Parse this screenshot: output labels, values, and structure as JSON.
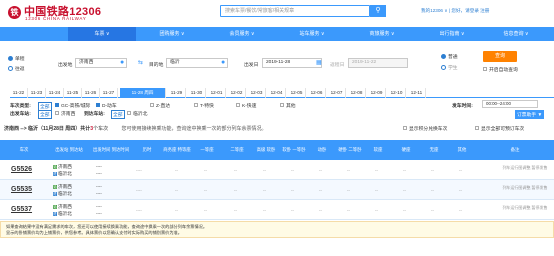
{
  "header": {
    "logo_char": "铁",
    "site_name": "中国铁路12306",
    "site_en": "12306 CHINA RAILWAY",
    "search_placeholder": "搜索车票/餐饮/常旅客/相关规章",
    "links": "我的12306 ∨  |  您好，请登录  注册"
  },
  "nav": [
    "首页",
    "车票 ∨",
    "团购服务 ∨",
    "会员服务 ∨",
    "站车服务 ∨",
    "商旅服务 ∨",
    "出行指南 ∨",
    "信息查询 ∨"
  ],
  "query": {
    "oneway": "单程",
    "roundtrip": "往返",
    "from_label": "出发地",
    "from_value": "济南西",
    "to_label": "目的地",
    "to_value": "临沂",
    "depart_label": "出发日",
    "depart_value": "2019-11-28",
    "return_label": "返程日",
    "return_value": "2019-11-22",
    "normal": "普通",
    "student": "学生",
    "submit": "查询",
    "auto": "开启自动查询"
  },
  "dates": [
    "11-22",
    "11-23",
    "11-24",
    "11-25",
    "11-26",
    "11-27",
    "11-28 周四",
    "11-29",
    "11-30",
    "12-01",
    "12-02",
    "12-03",
    "12-04",
    "12-05",
    "12-06",
    "12-07",
    "12-08",
    "12-09",
    "12-10",
    "12-11"
  ],
  "filters": {
    "type_label": "车次类型:",
    "all": "全部",
    "types": [
      "GC-高铁/城际",
      "D-动车",
      "Z-直达",
      "T-特快",
      "K-快速",
      "其他"
    ],
    "station_label": "出发车站:",
    "station_all": "全部",
    "stations": [
      "济南西"
    ],
    "arrive_label": "到达车站:",
    "arrive_all": "全部",
    "arrive_stations": [
      "临沂北"
    ],
    "time_label": "发车时间:",
    "time_value": "00:00--24:00",
    "sub_btn": "订票助手 ▼"
  },
  "summary": {
    "prefix": "济南西 --> 临沂（11月28日 周四）共计",
    "count": "3",
    "suffix": "个车次",
    "tip": "您可使用接续换乘功能，查询途中换乘一次的部分列车余票情况。",
    "opt1": "显示积分兑换车次",
    "opt2": "显示全部可预订车次"
  },
  "table_headers": [
    "车次",
    "出发站 到达站",
    "出发时间 到达时间",
    "历时",
    "商务座 特等座",
    "一等座",
    "二等座",
    "高级 软卧",
    "软卧 一等卧",
    "动卧",
    "硬卧 二等卧",
    "软座",
    "硬座",
    "无座",
    "其他",
    "备注"
  ],
  "trains": [
    {
      "code": "G5526",
      "from": "济南西",
      "to": "临沂北",
      "dep": "----",
      "arr": "----",
      "dur": "----",
      "note": "列车运行图调整,暂停发售"
    },
    {
      "code": "G5535",
      "from": "济南西",
      "to": "临沂北",
      "dep": "----",
      "arr": "----",
      "dur": "----",
      "note": "列车运行图调整,暂停发售"
    },
    {
      "code": "G5537",
      "from": "济南西",
      "to": "临沂北",
      "dep": "----",
      "arr": "----",
      "dur": "----",
      "note": "列车运行图调整,暂停发售"
    }
  ],
  "cell_dash": "--",
  "footer": {
    "line1": "如果查询结果中没有满足需求的车次，您还可以使用接续换乘功能，查询途中换乘一次的部分列车余票情况。",
    "line2": "显示的卧铺票价均为上铺票价，供您参考。具体票价以您确认支付时实际购买的铺别票价为准。"
  },
  "colors": {
    "brand": "#c8102e",
    "nav": "#3b99fc",
    "accent": "#ff8200"
  }
}
